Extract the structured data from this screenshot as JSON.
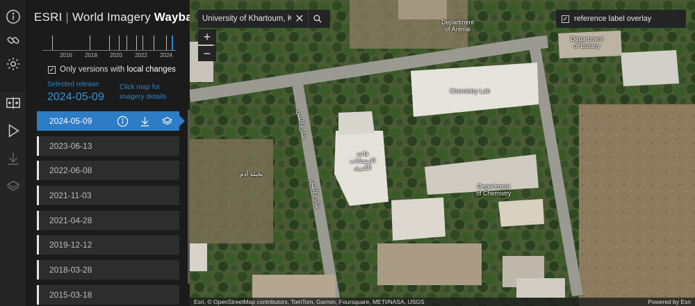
{
  "app": {
    "title_prefix": "ESRI",
    "title_sep": "|",
    "title_main": "World Imagery",
    "title_bold": "Wayback"
  },
  "timeline": {
    "years": [
      "2016",
      "2018",
      "2020",
      "2022",
      "2024"
    ]
  },
  "filter": {
    "label_prefix": "Only versions with",
    "label_bold": "local changes",
    "checked": true
  },
  "selected": {
    "label": "Selected release",
    "date": "2024-05-09",
    "hint": "Click map for imagery details"
  },
  "releases": [
    {
      "date": "2024-05-09",
      "active": true
    },
    {
      "date": "2023-06-13",
      "active": false
    },
    {
      "date": "2022-06-08",
      "active": false
    },
    {
      "date": "2021-11-03",
      "active": false
    },
    {
      "date": "2021-04-28",
      "active": false
    },
    {
      "date": "2019-12-12",
      "active": false
    },
    {
      "date": "2018-03-28",
      "active": false
    },
    {
      "date": "2015-03-18",
      "active": false
    }
  ],
  "icons": {
    "rail": [
      "info-icon",
      "link-icon",
      "gear-icon",
      "swipe-icon",
      "play-icon",
      "download-icon",
      "layers-icon"
    ],
    "release_actions": [
      "info-icon",
      "download-icon",
      "layers-icon"
    ]
  },
  "map": {
    "search_value": "University of Khartoum, K",
    "zoom_in": "+",
    "zoom_out": "−",
    "overlay_label": "reference label overlay",
    "overlay_checked": true,
    "labels": {
      "dept_animal": "Department\nof Animal",
      "dept_botany": "Department\nof Botany",
      "chem_lab": "Chemistry Lab",
      "dept_chem": "Department\nof Chemistry",
      "hall_ar": "قاعة\nالامتحانات\nالكبرى",
      "street_ar_1": "شارع المين",
      "street_ar_2": "شارع المين",
      "place_ar": "نخيلة آدم"
    },
    "attribution": "Esri, © OpenStreetMap contributors, TomTom, Garmin, Foursquare, METI/NASA, USGS",
    "powered_by": "Powered by Esri"
  },
  "colors": {
    "accent": "#2e7cc4",
    "panel_bg": "#1b1b1b",
    "item_bg": "#2d2d2d"
  }
}
